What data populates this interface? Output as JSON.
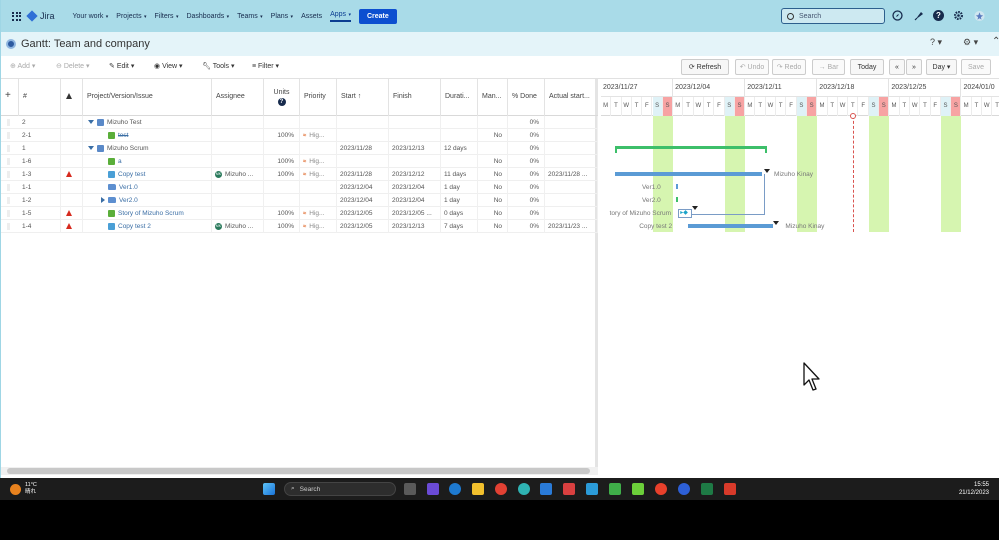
{
  "nav": {
    "logo": "Jira",
    "items": [
      {
        "label": "Your work",
        "caret": true
      },
      {
        "label": "Projects",
        "caret": true
      },
      {
        "label": "Filters",
        "caret": true
      },
      {
        "label": "Dashboards",
        "caret": true
      },
      {
        "label": "Teams",
        "caret": true
      },
      {
        "label": "Plans",
        "caret": true
      },
      {
        "label": "Assets",
        "caret": false
      },
      {
        "label": "Apps",
        "caret": true,
        "active": true
      }
    ],
    "create_label": "Create",
    "search_placeholder": "Search"
  },
  "page": {
    "title": "Gantt:  Team and company"
  },
  "toolbar": {
    "add": "Add",
    "delete": "Delete",
    "edit": "Edit",
    "view": "View",
    "tools": "Tools",
    "filter": "Filter",
    "refresh": "Refresh",
    "undo": "Undo",
    "redo": "Redo",
    "bar": "Bar",
    "today": "Today",
    "prev": "«",
    "next": "»",
    "scale": "Day",
    "save": "Save"
  },
  "grid": {
    "columns": [
      "#",
      "Project/Version/Issue",
      "Assignee",
      "Units",
      "Priority",
      "Start ↑",
      "Finish",
      "Durati...",
      "Man...",
      "% Done",
      "Actual start..."
    ],
    "rows": [
      {
        "num": "2",
        "warn": false,
        "indent": 0,
        "caret": "down",
        "icon": "proj",
        "name": "Mizuho Test",
        "link": false,
        "strike": false,
        "assignee": "",
        "units": "",
        "priority": "",
        "start": "",
        "finish": "",
        "duration": "",
        "manual": "",
        "done": "0%",
        "actual": ""
      },
      {
        "num": "2-1",
        "warn": false,
        "indent": 1,
        "caret": "",
        "icon": "story",
        "name": "test",
        "link": true,
        "strike": true,
        "assignee": "",
        "units": "100%",
        "priority": "Hig...",
        "start": "",
        "finish": "",
        "duration": "",
        "manual": "No",
        "done": "0%",
        "actual": ""
      },
      {
        "num": "1",
        "warn": false,
        "indent": 0,
        "caret": "down",
        "icon": "proj",
        "name": "Mizuho Scrum",
        "link": false,
        "strike": false,
        "assignee": "",
        "units": "",
        "priority": "",
        "start": "2023/11/28",
        "finish": "2023/12/13",
        "duration": "12 days",
        "manual": "",
        "done": "0%",
        "actual": ""
      },
      {
        "num": "1-6",
        "warn": false,
        "indent": 1,
        "caret": "",
        "icon": "story",
        "name": "a",
        "link": true,
        "strike": false,
        "assignee": "",
        "units": "100%",
        "priority": "Hig...",
        "start": "",
        "finish": "",
        "duration": "",
        "manual": "No",
        "done": "0%",
        "actual": ""
      },
      {
        "num": "1-3",
        "warn": true,
        "indent": 1,
        "caret": "",
        "icon": "task",
        "name": "Copy test",
        "link": true,
        "strike": false,
        "assignee": "Mizuho ...",
        "avatar": "MK",
        "units": "100%",
        "priority": "Hig...",
        "start": "2023/11/28",
        "finish": "2023/12/12",
        "duration": "11 days",
        "manual": "No",
        "done": "0%",
        "actual": "2023/11/28 ..."
      },
      {
        "num": "1-1",
        "warn": false,
        "indent": 1,
        "caret": "",
        "icon": "folder",
        "name": "Ver1.0",
        "link": true,
        "strike": false,
        "assignee": "",
        "units": "",
        "priority": "",
        "start": "2023/12/04",
        "finish": "2023/12/04",
        "duration": "1 day",
        "manual": "No",
        "done": "0%",
        "actual": ""
      },
      {
        "num": "1-2",
        "warn": false,
        "indent": 1,
        "caret": "right",
        "icon": "folder",
        "name": "Ver2.0",
        "link": true,
        "strike": false,
        "assignee": "",
        "units": "",
        "priority": "",
        "start": "2023/12/04",
        "finish": "2023/12/04",
        "duration": "1 day",
        "manual": "No",
        "done": "0%",
        "actual": ""
      },
      {
        "num": "1-5",
        "warn": true,
        "indent": 1,
        "caret": "",
        "icon": "story",
        "name": "Story of Mizuho Scrum",
        "link": true,
        "strike": false,
        "assignee": "",
        "units": "100%",
        "priority": "Hig...",
        "start": "2023/12/05",
        "finish": "2023/12/05 ...",
        "duration": "0 days",
        "manual": "No",
        "done": "0%",
        "actual": ""
      },
      {
        "num": "1-4",
        "warn": true,
        "indent": 1,
        "caret": "",
        "icon": "task",
        "name": "Copy test 2",
        "link": true,
        "strike": false,
        "assignee": "Mizuho ...",
        "avatar": "MK",
        "units": "100%",
        "priority": "Hig...",
        "start": "2023/12/05",
        "finish": "2023/12/13",
        "duration": "7 days",
        "manual": "No",
        "done": "0%",
        "actual": "2023/11/23 ..."
      }
    ]
  },
  "gantt": {
    "weeks": [
      "2023/11/27",
      "2023/12/04",
      "2023/12/11",
      "2023/12/18",
      "2023/12/25",
      "2024/01/0"
    ],
    "day_letters": [
      "M",
      "T",
      "W",
      "T",
      "F",
      "S",
      "S"
    ],
    "labels": {
      "copy_test": "Mizuho Kinay",
      "ver1": "Ver1.0",
      "ver2": "Ver2.0",
      "story": "tory of Mizuho Scrum",
      "copy_test2_left": "Copy test 2",
      "copy_test2_right": "Mizuho Kinay"
    },
    "colors": {
      "summary": "#3dbf6a",
      "task": "#5b9bd5",
      "weekend_highlight": "#d6f5b0",
      "sunday": "#f7a3a3",
      "today_line": "#d9534f"
    }
  },
  "taskbar": {
    "weather_temp": "11°C",
    "weather_desc": "晴れ",
    "search_placeholder": "Search",
    "time": "15:55",
    "date": "21/12/2023"
  }
}
